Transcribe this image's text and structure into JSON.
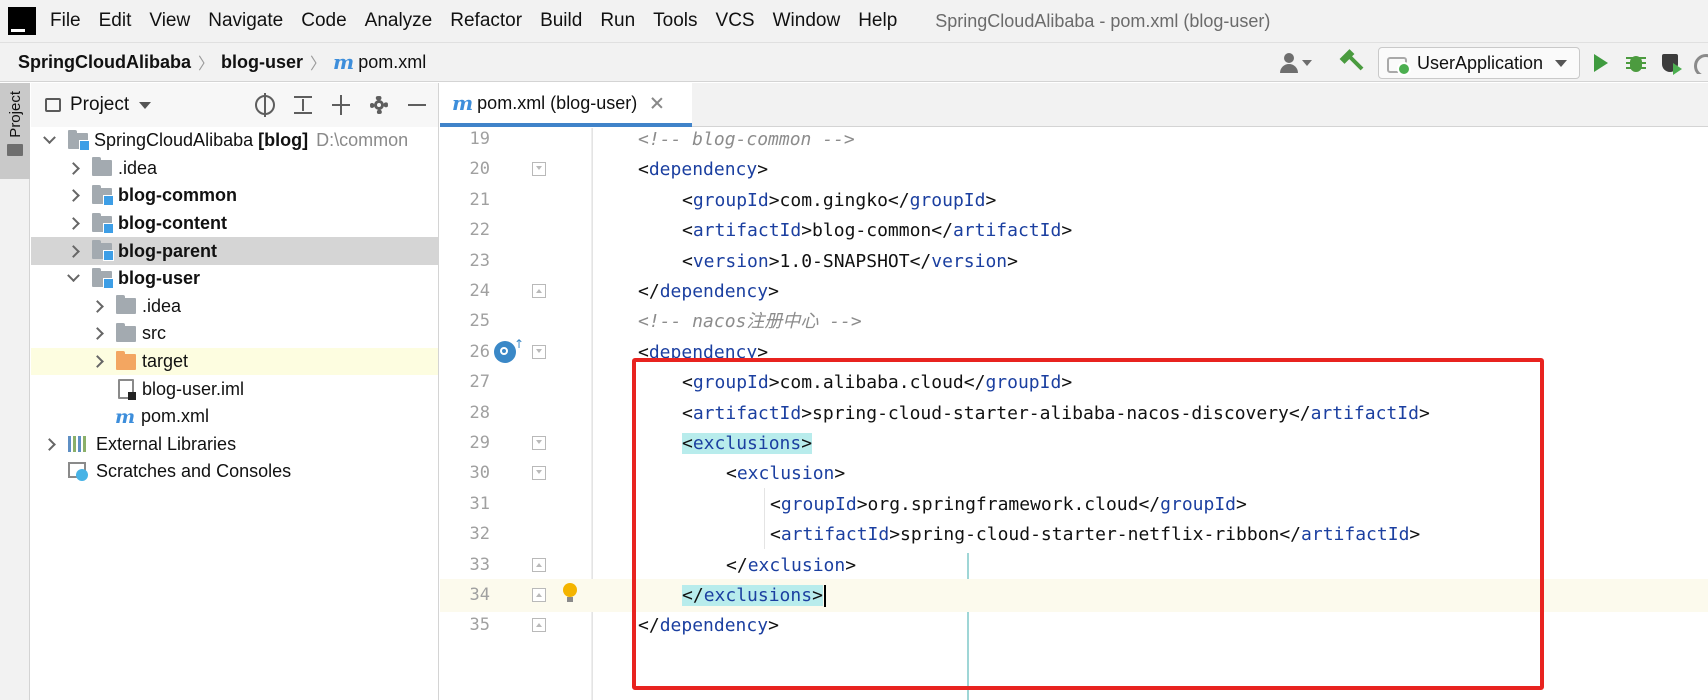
{
  "menubar": {
    "items": [
      "File",
      "Edit",
      "View",
      "Navigate",
      "Code",
      "Analyze",
      "Refactor",
      "Build",
      "Run",
      "Tools",
      "VCS",
      "Window",
      "Help"
    ],
    "window_title": "SpringCloudAlibaba - pom.xml (blog-user)"
  },
  "navbar": {
    "breadcrumb": [
      "SpringCloudAlibaba",
      "blog-user",
      "pom.xml"
    ],
    "run_config": "UserApplication"
  },
  "stripe": {
    "project_label": "Project"
  },
  "project_panel": {
    "title": "Project",
    "tree": [
      {
        "label": "SpringCloudAlibaba",
        "suffix": "[blog]",
        "path": "D:\\common"
      },
      {
        "label": ".idea"
      },
      {
        "label": "blog-common"
      },
      {
        "label": "blog-content"
      },
      {
        "label": "blog-parent"
      },
      {
        "label": "blog-user"
      },
      {
        "label": ".idea"
      },
      {
        "label": "src"
      },
      {
        "label": "target"
      },
      {
        "label": "blog-user.iml"
      },
      {
        "label": "pom.xml"
      },
      {
        "label": "External Libraries"
      },
      {
        "label": "Scratches and Consoles"
      }
    ]
  },
  "editor": {
    "tab_label": "pom.xml (blog-user)",
    "lines": [
      {
        "n": "19",
        "indent": 1,
        "parts": [
          {
            "t": "comment",
            "v": "<!-- blog-common -->"
          }
        ]
      },
      {
        "n": "20",
        "indent": 1,
        "parts": [
          {
            "t": "text",
            "v": "<"
          },
          {
            "t": "tag",
            "v": "dependency"
          },
          {
            "t": "text",
            "v": ">"
          }
        ]
      },
      {
        "n": "21",
        "indent": 2,
        "parts": [
          {
            "t": "text",
            "v": "<"
          },
          {
            "t": "tag",
            "v": "groupId"
          },
          {
            "t": "text",
            "v": ">com.gingko</"
          },
          {
            "t": "tag",
            "v": "groupId"
          },
          {
            "t": "text",
            "v": ">"
          }
        ]
      },
      {
        "n": "22",
        "indent": 2,
        "parts": [
          {
            "t": "text",
            "v": "<"
          },
          {
            "t": "tag",
            "v": "artifactId"
          },
          {
            "t": "text",
            "v": ">blog-common</"
          },
          {
            "t": "tag",
            "v": "artifactId"
          },
          {
            "t": "text",
            "v": ">"
          }
        ]
      },
      {
        "n": "23",
        "indent": 2,
        "parts": [
          {
            "t": "text",
            "v": "<"
          },
          {
            "t": "tag",
            "v": "version"
          },
          {
            "t": "text",
            "v": ">1.0-SNAPSHOT</"
          },
          {
            "t": "tag",
            "v": "version"
          },
          {
            "t": "text",
            "v": ">"
          }
        ]
      },
      {
        "n": "24",
        "indent": 1,
        "parts": [
          {
            "t": "text",
            "v": "</"
          },
          {
            "t": "tag",
            "v": "dependency"
          },
          {
            "t": "text",
            "v": ">"
          }
        ]
      },
      {
        "n": "25",
        "indent": 1,
        "parts": [
          {
            "t": "comment",
            "v": "<!-- nacos注册中心 -->"
          }
        ]
      },
      {
        "n": "26",
        "indent": 1,
        "parts": [
          {
            "t": "text",
            "v": "<"
          },
          {
            "t": "tag",
            "v": "dependency"
          },
          {
            "t": "text",
            "v": ">"
          }
        ]
      },
      {
        "n": "27",
        "indent": 2,
        "parts": [
          {
            "t": "text",
            "v": "<"
          },
          {
            "t": "tag",
            "v": "groupId"
          },
          {
            "t": "text",
            "v": ">com.alibaba.cloud</"
          },
          {
            "t": "tag",
            "v": "groupId"
          },
          {
            "t": "text",
            "v": ">"
          }
        ]
      },
      {
        "n": "28",
        "indent": 2,
        "parts": [
          {
            "t": "text",
            "v": "<"
          },
          {
            "t": "tag",
            "v": "artifactId"
          },
          {
            "t": "text",
            "v": ">spring-cloud-starter-alibaba-nacos-discovery</"
          },
          {
            "t": "tag",
            "v": "artifactId"
          },
          {
            "t": "text",
            "v": ">"
          }
        ]
      },
      {
        "n": "29",
        "indent": 2,
        "parts": [
          {
            "t": "hl",
            "v": "<"
          },
          {
            "t": "hltag",
            "v": "exclusions"
          },
          {
            "t": "hl",
            "v": ">"
          }
        ]
      },
      {
        "n": "30",
        "indent": 3,
        "parts": [
          {
            "t": "text",
            "v": "<"
          },
          {
            "t": "tag",
            "v": "exclusion"
          },
          {
            "t": "text",
            "v": ">"
          }
        ]
      },
      {
        "n": "31",
        "indent": 4,
        "parts": [
          {
            "t": "text",
            "v": "<"
          },
          {
            "t": "tag",
            "v": "groupId"
          },
          {
            "t": "text",
            "v": ">org.springframework.cloud</"
          },
          {
            "t": "tag",
            "v": "groupId"
          },
          {
            "t": "text",
            "v": ">"
          }
        ]
      },
      {
        "n": "32",
        "indent": 4,
        "parts": [
          {
            "t": "text",
            "v": "<"
          },
          {
            "t": "tag",
            "v": "artifactId"
          },
          {
            "t": "text",
            "v": ">spring-cloud-starter-netflix-ribbon</"
          },
          {
            "t": "tag",
            "v": "artifactId"
          },
          {
            "t": "text",
            "v": ">"
          }
        ]
      },
      {
        "n": "33",
        "indent": 3,
        "parts": [
          {
            "t": "text",
            "v": "</"
          },
          {
            "t": "tag",
            "v": "exclusion"
          },
          {
            "t": "text",
            "v": ">"
          }
        ]
      },
      {
        "n": "34",
        "indent": 2,
        "parts": [
          {
            "t": "hl",
            "v": "</"
          },
          {
            "t": "hltag",
            "v": "exclusions"
          },
          {
            "t": "hl",
            "v": ">"
          }
        ]
      },
      {
        "n": "35",
        "indent": 1,
        "parts": [
          {
            "t": "text",
            "v": "</"
          },
          {
            "t": "tag",
            "v": "dependency"
          },
          {
            "t": "text",
            "v": ">"
          }
        ]
      }
    ]
  },
  "colors": {
    "tag": "#1b3fa0",
    "comment": "#8c8c8c",
    "highlight_bg": "#b8ecec",
    "annotation_box": "#e8231f",
    "tab_underline": "#4083c9"
  }
}
